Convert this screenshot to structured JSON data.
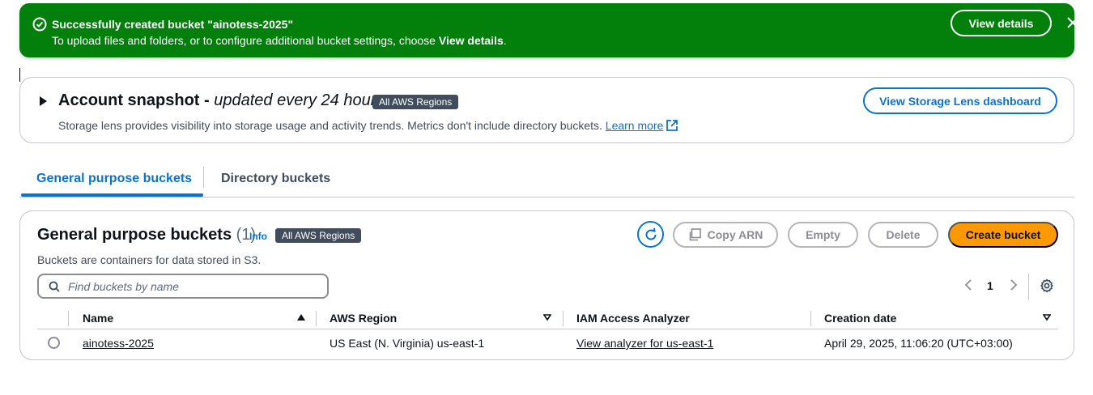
{
  "colors": {
    "success": "#037f0c",
    "accent": "#0972d3",
    "primary_button": "#ff9900",
    "badge": "#414d5c"
  },
  "flash": {
    "icon": "check-circle-icon",
    "title": "Successfully created bucket \"ainotess-2025\"",
    "message_prefix": "To upload files and folders, or to configure additional bucket settings, choose ",
    "message_bold": "View details",
    "message_suffix": ".",
    "view_details_label": "View details",
    "close_icon": "close-icon"
  },
  "snapshot": {
    "title": "Account snapshot - ",
    "title_italic": "updated every 24 hours",
    "badge": "All AWS Regions",
    "description": "Storage lens provides visibility into storage usage and activity trends. Metrics don't include directory buckets. ",
    "learn_more": "Learn more",
    "lens_button": "View Storage Lens dashboard"
  },
  "tabs": [
    {
      "label": "General purpose buckets",
      "active": true
    },
    {
      "label": "Directory buckets",
      "active": false
    }
  ],
  "buckets": {
    "title": "General purpose buckets",
    "count": "(1)",
    "info": "Info",
    "badge": "All AWS Regions",
    "description": "Buckets are containers for data stored in S3.",
    "buttons": {
      "copy_arn": "Copy ARN",
      "empty": "Empty",
      "delete": "Delete",
      "create": "Create bucket"
    },
    "search_placeholder": "Find buckets by name",
    "page": "1",
    "columns": [
      "Name",
      "AWS Region",
      "IAM Access Analyzer",
      "Creation date"
    ],
    "rows": [
      {
        "name": "ainotess-2025",
        "region": "US East (N. Virginia) us-east-1",
        "analyzer": "View analyzer for us-east-1",
        "created": "April 29, 2025, 11:06:20 (UTC+03:00)"
      }
    ]
  }
}
